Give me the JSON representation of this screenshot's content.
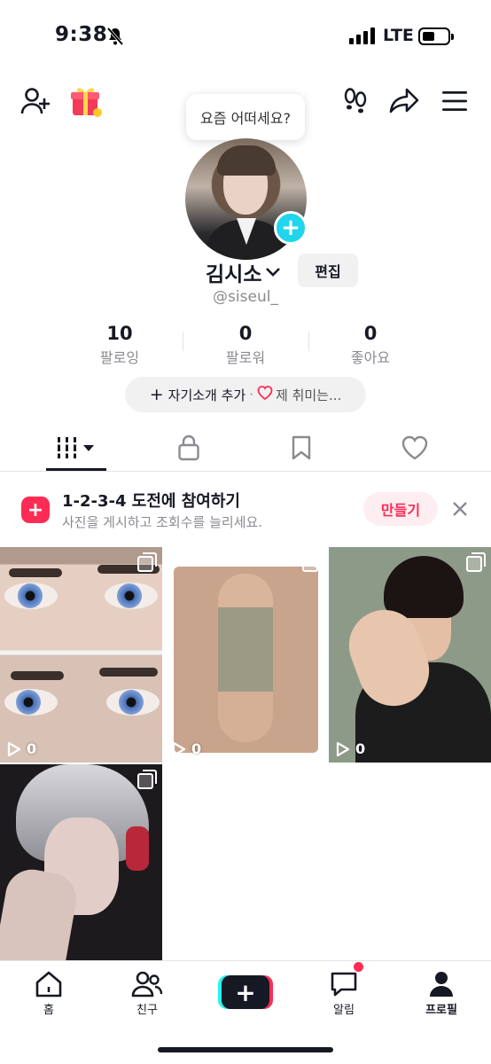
{
  "status_bar": {
    "time": "9:38",
    "network": "LTE"
  },
  "header": {
    "tooltip": "요즘 어떠세요?"
  },
  "profile": {
    "name": "김시소",
    "edit_label": "편집",
    "handle": "@siseul_",
    "stats": [
      {
        "value": "10",
        "label": "팔로잉"
      },
      {
        "value": "0",
        "label": "팔로워"
      },
      {
        "value": "0",
        "label": "좋아요"
      }
    ],
    "bio_add_label": "자기소개 추가",
    "bio_separator": "·",
    "bio_hint": "제 취미는..."
  },
  "banner": {
    "title": "1-2-3-4 도전에 참여하기",
    "subtitle": "사진을 게시하고 조회수를 늘리세요.",
    "action_label": "만들기"
  },
  "posts": [
    {
      "views": "0",
      "icon": "multi-photo-icon"
    },
    {
      "views": "0",
      "icon": "multi-photo-icon"
    },
    {
      "views": "0",
      "icon": "multi-photo-icon"
    },
    {
      "views": "",
      "icon": "multi-photo-icon"
    }
  ],
  "bottom_nav": [
    {
      "label": "홈",
      "icon": "home-icon"
    },
    {
      "label": "친구",
      "icon": "friends-icon"
    },
    {
      "label": "",
      "icon": "create-icon"
    },
    {
      "label": "알림",
      "icon": "inbox-icon"
    },
    {
      "label": "프로필",
      "icon": "profile-icon"
    }
  ],
  "colors": {
    "accent": "#fe2c55",
    "cyan": "#25f4ee",
    "avatar_plus": "#20d5ec",
    "text": "#161823",
    "muted": "#8a8b91"
  }
}
